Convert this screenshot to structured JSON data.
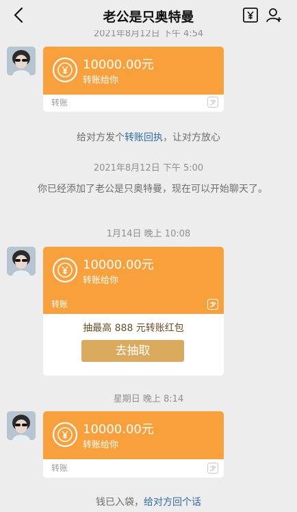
{
  "header": {
    "title": "老公是只奥特曼"
  },
  "colors": {
    "transfer_orange": "#f7a03c",
    "background": "#ededed",
    "link": "#2f6aa8",
    "button": "#d9a95d"
  },
  "icons": [
    "back-arrow-icon",
    "transfer-icon",
    "person-icon",
    "yuan-coin-icon",
    "alipay-logo-icon"
  ],
  "timestamps": {
    "t0": "2021年8月12日 下午 4:54",
    "t1": "2021年8月12日 下午 5:00",
    "t2": "1月14日 晚上 10:08",
    "t3": "星期日 晚上 8:14"
  },
  "messages": {
    "m1": {
      "amount": "10000.00元",
      "sub": "转账给你",
      "footer": "转账"
    },
    "m2": {
      "amount": "10000.00元",
      "sub": "转账给你",
      "footer": "转账",
      "redpack_text": "抽最高 888 元转账红包",
      "button": "去抽取"
    },
    "m3": {
      "amount": "10000.00元",
      "sub": "转账给你",
      "footer": "转账"
    }
  },
  "system": {
    "receipt_pre": "给对方发个",
    "receipt_link": "转账回执",
    "receipt_post": "，让对方放心",
    "added_text": "你已经添加了老公是只奥特曼，现在可以开始聊天了。",
    "received_pre": "钱已入袋，",
    "received_link": "给对方回个话"
  }
}
